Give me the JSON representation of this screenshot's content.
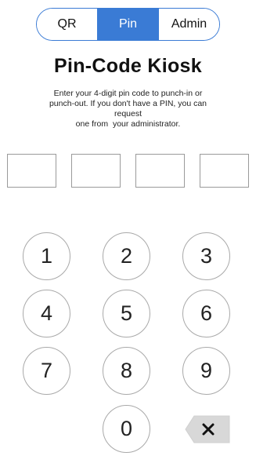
{
  "tabs": [
    {
      "label": "QR",
      "active": false
    },
    {
      "label": "Pin",
      "active": true
    },
    {
      "label": "Admin",
      "active": false
    }
  ],
  "title": "Pin-Code Kiosk",
  "instructions": {
    "line1": "Enter your 4-digit pin code to punch-in or",
    "line2": "punch-out. If you don't have a PIN, you can request",
    "line3": "one from  your administrator."
  },
  "pin_slots": [
    "",
    "",
    "",
    ""
  ],
  "keypad": {
    "k1": "1",
    "k2": "2",
    "k3": "3",
    "k4": "4",
    "k5": "5",
    "k6": "6",
    "k7": "7",
    "k8": "8",
    "k9": "9",
    "k0": "0",
    "backspace_icon": "backspace-icon"
  },
  "colors": {
    "accent": "#3a7bd5",
    "backspace_bg": "#d8d8d8"
  }
}
